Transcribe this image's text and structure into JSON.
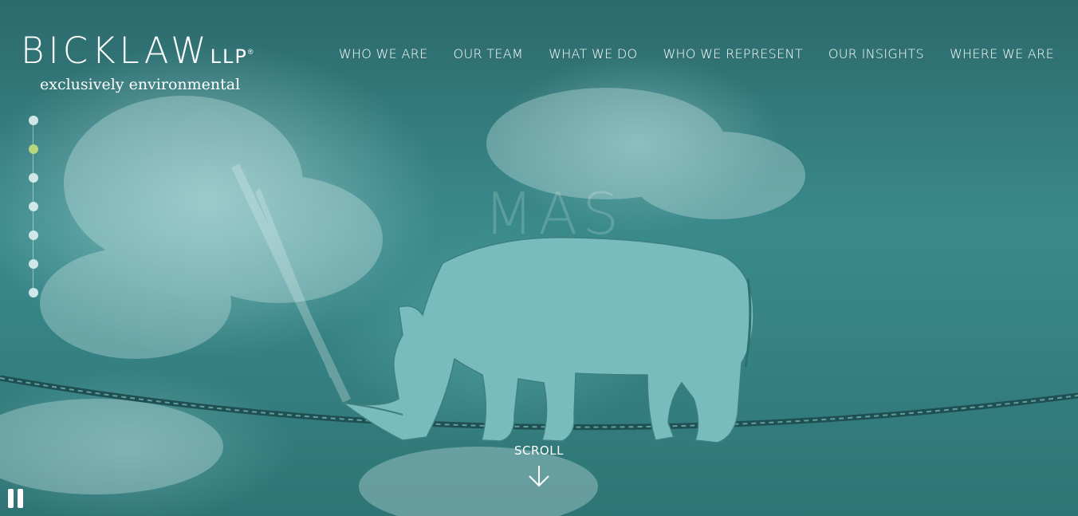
{
  "logo": {
    "main": "BICKLAW",
    "suffix": "LLP",
    "reg": "®",
    "tagline": "exclusively environmental"
  },
  "nav": {
    "items": [
      "WHO WE ARE",
      "OUR TEAM",
      "WHAT WE DO",
      "WHO WE REPRESENT",
      "OUR INSIGHTS",
      "WHERE WE ARE"
    ]
  },
  "slides": {
    "count": 7,
    "active_index": 1
  },
  "hero": {
    "word": "MAS",
    "image": "rhino-on-tightrope"
  },
  "scroll": {
    "label": "SCROLL",
    "icon": "arrow-down-icon"
  },
  "controls": {
    "pause_icon": "pause-icon"
  },
  "colors": {
    "accent_dot": "#b6d77d",
    "overlay": "#2f6f70",
    "text": "#ffffff"
  }
}
